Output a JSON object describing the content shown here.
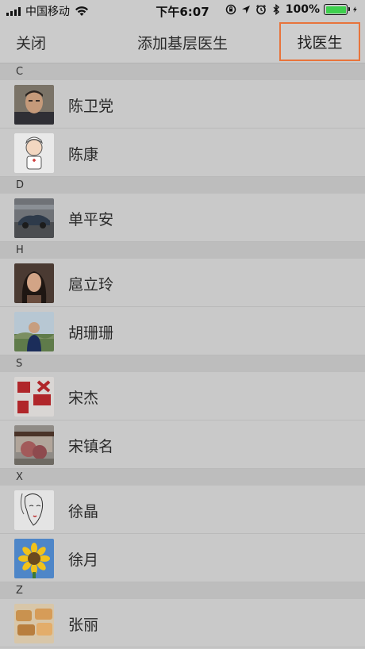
{
  "status_bar": {
    "carrier": "中国移动",
    "time": "下午6:07",
    "battery": "100%",
    "battery_color": "#3ecf4d"
  },
  "nav": {
    "close_label": "关闭",
    "title": "添加基层医生",
    "find_label": "找医生",
    "highlight_color": "#e8743b"
  },
  "sections": [
    {
      "letter": "C",
      "doctors": [
        {
          "name": "陈卫党",
          "avatar": "photo-man-portrait"
        },
        {
          "name": "陈康",
          "avatar": "cartoon-doctor"
        }
      ]
    },
    {
      "letter": "D",
      "doctors": [
        {
          "name": "单平安",
          "avatar": "photo-cars"
        }
      ]
    },
    {
      "letter": "H",
      "doctors": [
        {
          "name": "扈立玲",
          "avatar": "photo-woman-portrait"
        },
        {
          "name": "胡珊珊",
          "avatar": "photo-woman-outdoor"
        }
      ]
    },
    {
      "letter": "S",
      "doctors": [
        {
          "name": "宋杰",
          "avatar": "photo-red-logo"
        },
        {
          "name": "宋镇名",
          "avatar": "photo-house-tree"
        }
      ]
    },
    {
      "letter": "X",
      "doctors": [
        {
          "name": "徐晶",
          "avatar": "sketch-woman"
        },
        {
          "name": "徐月",
          "avatar": "photo-sunflower"
        }
      ]
    },
    {
      "letter": "Z",
      "doctors": [
        {
          "name": "张丽",
          "avatar": "photo-food"
        }
      ]
    }
  ]
}
